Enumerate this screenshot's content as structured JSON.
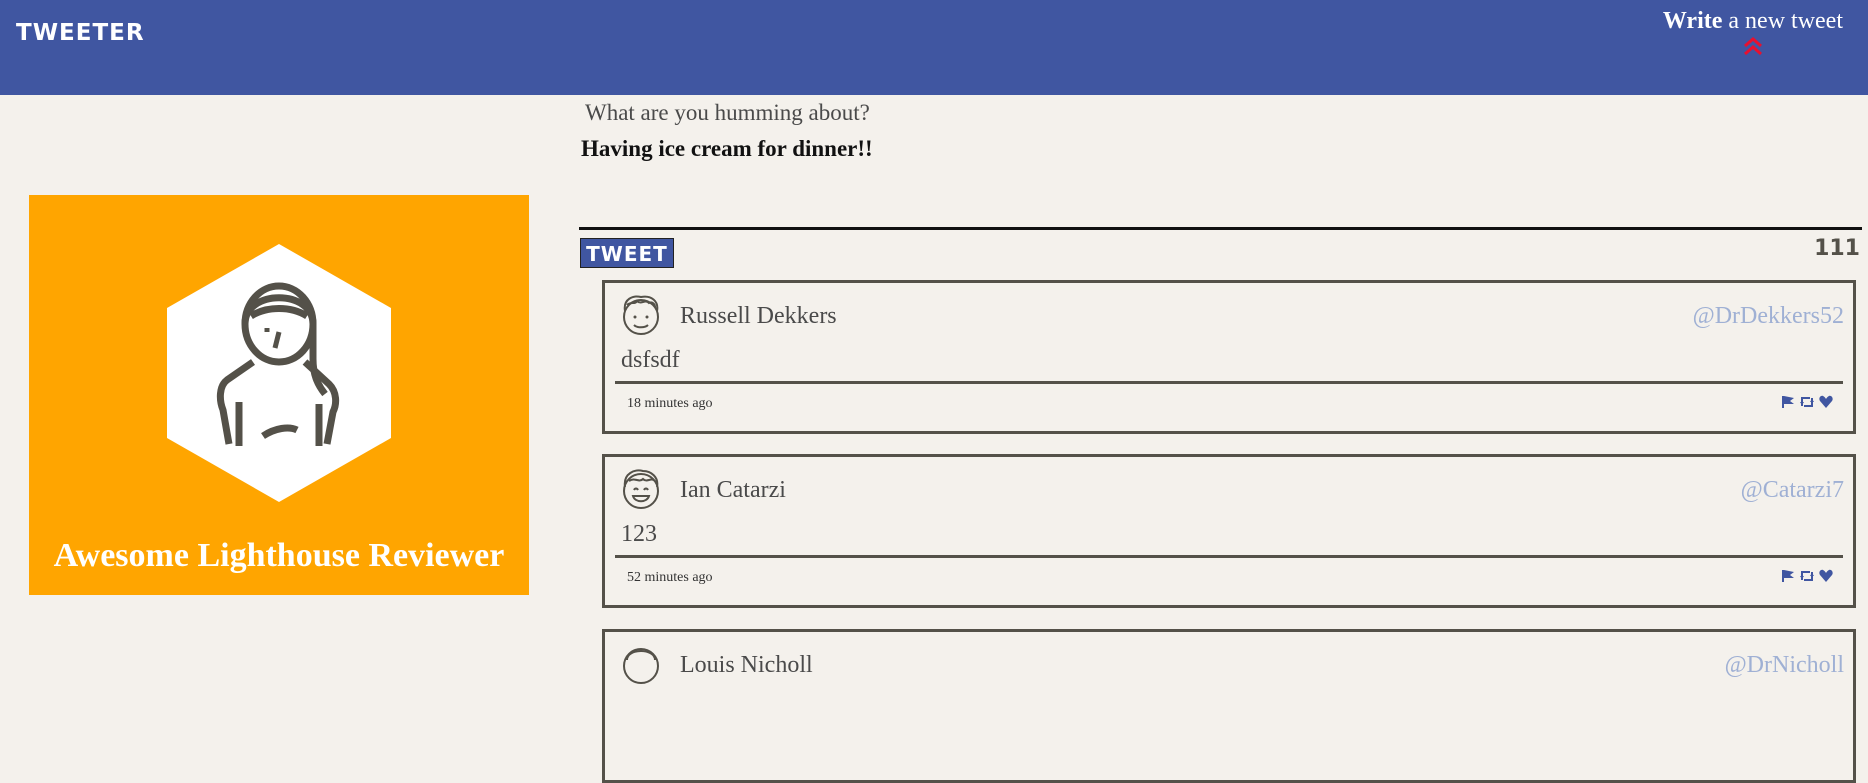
{
  "nav": {
    "brand": "TWEETER",
    "compose_strong": "Write",
    "compose_rest": " a new tweet"
  },
  "profile": {
    "name": "Awesome Lighthouse Reviewer"
  },
  "composer": {
    "prompt": "What are you humming about?",
    "draft_text": "Having ice cream for dinner!!",
    "button_label": "TWEET",
    "counter": "111"
  },
  "tweets": [
    {
      "name": "Russell Dekkers",
      "handle": "@DrDekkers52",
      "text": "dsfsdf",
      "time": "18 minutes ago"
    },
    {
      "name": "Ian Catarzi",
      "handle": "@Catarzi7",
      "text": "123",
      "time": "52 minutes ago"
    },
    {
      "name": "Louis Nicholl",
      "handle": "@DrNicholl",
      "text": "",
      "time": ""
    }
  ],
  "colors": {
    "nav_bg": "#4056a1",
    "profile_bg": "#ffa500",
    "accent_red": "#e8102f",
    "page_bg": "#f4f1ec",
    "handle": "#9fb0d4"
  },
  "icons": {
    "compose": "double-chevron-up-icon",
    "flag": "flag-icon",
    "retweet": "retweet-icon",
    "like": "heart-icon"
  }
}
